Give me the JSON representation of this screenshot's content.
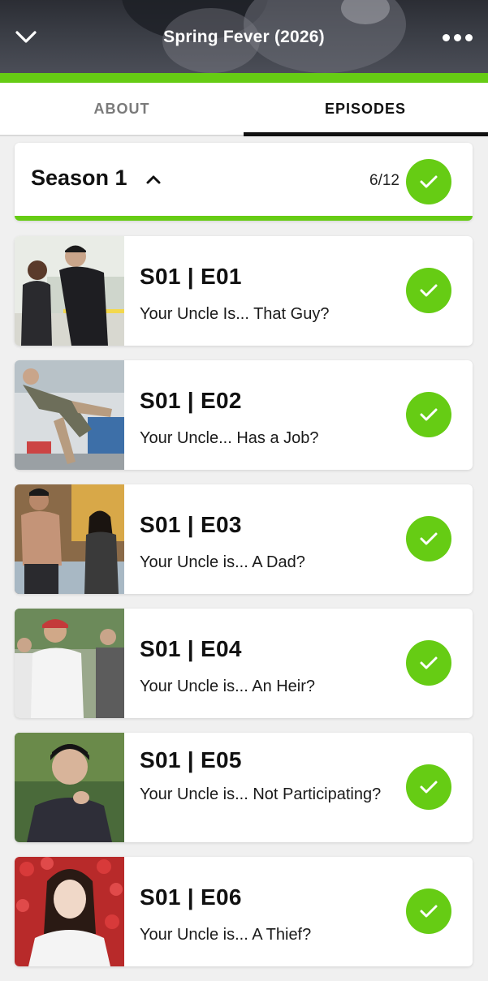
{
  "header": {
    "title": "Spring Fever (2026)",
    "back_icon": "chevron-down-icon",
    "more_icon": "more-dots-icon",
    "accent": "#66cc14"
  },
  "tabs": [
    {
      "label": "ABOUT",
      "active": false
    },
    {
      "label": "EPISODES",
      "active": true
    }
  ],
  "season": {
    "label": "Season 1",
    "watched_count": "6/12",
    "expanded": true,
    "completed": true
  },
  "episodes": [
    {
      "code": "S01 | E01",
      "title": "Your Uncle Is... That Guy?",
      "watched": true
    },
    {
      "code": "S01 | E02",
      "title": "Your Uncle... Has a Job?",
      "watched": true
    },
    {
      "code": "S01 | E03",
      "title": "Your Uncle is... A Dad?",
      "watched": true
    },
    {
      "code": "S01 | E04",
      "title": "Your Uncle is... An Heir?",
      "watched": true
    },
    {
      "code": "S01 | E05",
      "title": "Your Uncle is... Not Participating?",
      "watched": true
    },
    {
      "code": "S01 | E06",
      "title": "Your Uncle is... A Thief?",
      "watched": true
    }
  ]
}
